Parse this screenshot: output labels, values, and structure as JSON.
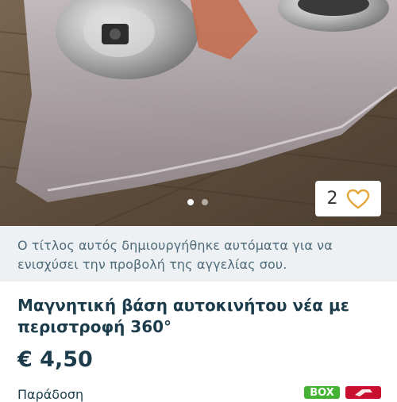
{
  "gallery": {
    "image_count": 2,
    "active_index": 0
  },
  "favorites": {
    "count": "2",
    "icon": "heart-outline-icon",
    "icon_color": "#e2a63a"
  },
  "notice": {
    "text": "Ο τίτλος αυτός δημιουργήθηκε αυτόματα για να ενισχύσει την προβολή της αγγελίας σου."
  },
  "listing": {
    "title": "Μαγνητική βάση αυτοκινήτου νέα με περιστροφή 360°",
    "price": "€ 4,50",
    "partial_label": "Παράδοση"
  },
  "badges": {
    "box_label": "BOX",
    "box_color": "#44b233",
    "courier_icon": "courier-logo-icon",
    "courier_color": "#c8102e"
  }
}
